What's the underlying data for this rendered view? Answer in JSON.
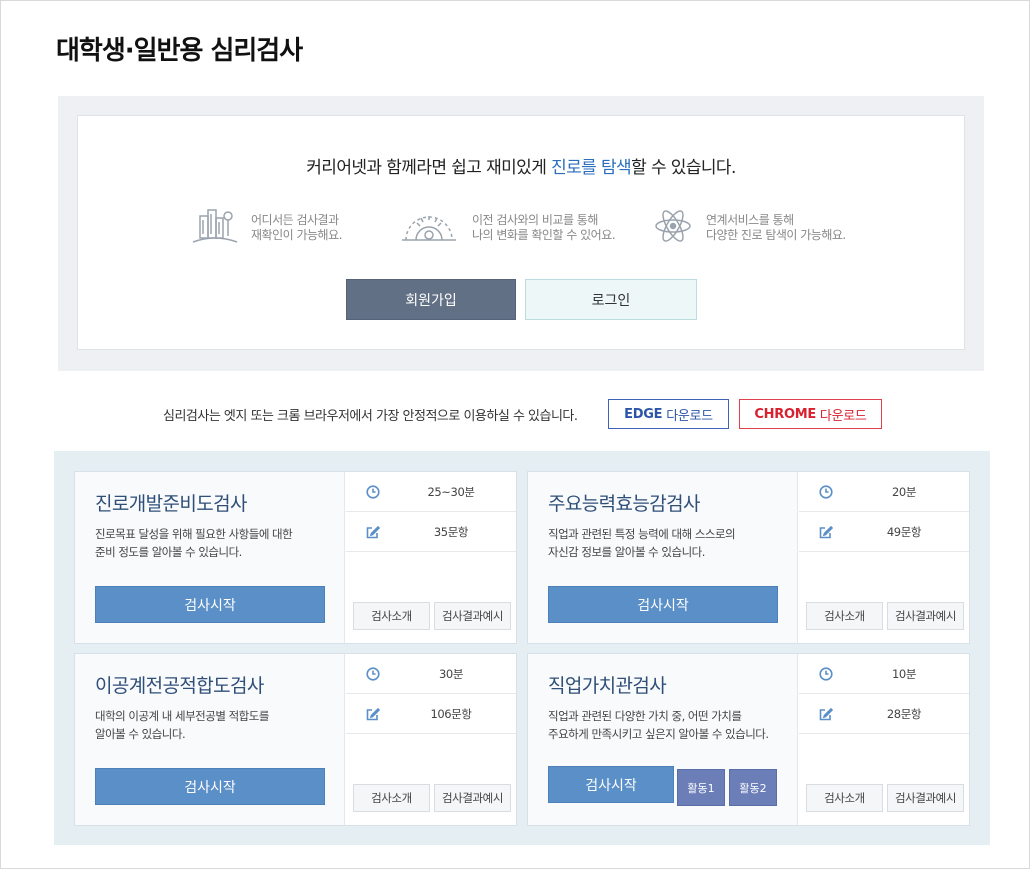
{
  "page": {
    "title": "대학생·일반용 심리검사"
  },
  "login": {
    "headline_before": "커리어넷과 함께라면 쉽고 재미있게 ",
    "headline_highlight": "진로를 탐색",
    "headline_after": "할 수 있습니다.",
    "features": [
      {
        "icon": "city-search-icon",
        "line1": "어디서든 검사결과",
        "line2": "재확인이 가능해요."
      },
      {
        "icon": "gear-compare-icon",
        "line1": "이전 검사와의 비교를 통해",
        "line2": "나의 변화를 확인할 수 있어요."
      },
      {
        "icon": "atom-icon",
        "line1": "연계서비스를 통해",
        "line2": "다양한 진로 탐색이 가능해요."
      }
    ],
    "join_label": "회원가입",
    "login_label": "로그인",
    "colors": {
      "join_bg": "#627085",
      "login_bg": "#eef7f8",
      "highlight": "#2a6ebd"
    }
  },
  "browser": {
    "note": "심리검사는 엣지 또는 크롬 브라우저에서 가장 안정적으로 이용하실 수 있습니다.",
    "edge_strong": "EDGE",
    "edge_light": "다운로드",
    "chrome_strong": "CHROME",
    "chrome_light": "다운로드",
    "colors": {
      "edge": "#2c55a8",
      "chrome": "#d8202f"
    }
  },
  "tests": [
    {
      "title": "진로개발준비도검사",
      "desc1": "진로목표 달성을 위해 필요한 사항들에 대한",
      "desc2": "준비 정도를 알아볼 수 있습니다.",
      "time": "25~30분",
      "items": "35문항",
      "start": "검사시작",
      "intro": "검사소개",
      "example": "검사결과예시"
    },
    {
      "title": "주요능력효능감검사",
      "desc1": "직업과 관련된 특정 능력에 대해 스스로의",
      "desc2": "자신감 정보를 알아볼 수 있습니다.",
      "time": "20분",
      "items": "49문항",
      "start": "검사시작",
      "intro": "검사소개",
      "example": "검사결과예시"
    },
    {
      "title": "이공계전공적합도검사",
      "desc1": "대학의 이공계 내 세부전공별 적합도를",
      "desc2": "알아볼 수 있습니다.",
      "time": "30분",
      "items": "106문항",
      "start": "검사시작",
      "intro": "검사소개",
      "example": "검사결과예시"
    },
    {
      "title": "직업가치관검사",
      "desc1": "직업과 관련된 다양한 가치 중, 어떤 가치를",
      "desc2": "주요하게 만족시키고 싶은지 알아볼 수 있습니다.",
      "time": "10분",
      "items": "28문항",
      "start": "검사시작",
      "activity1": "활동1",
      "activity2": "활동2",
      "intro": "검사소개",
      "example": "검사결과예시"
    }
  ],
  "colors": {
    "start_button": "#5b8fc8",
    "activity_button": "#6b7eb8",
    "test_title": "#2f4f78",
    "panel_bg": "#e5eff3"
  }
}
